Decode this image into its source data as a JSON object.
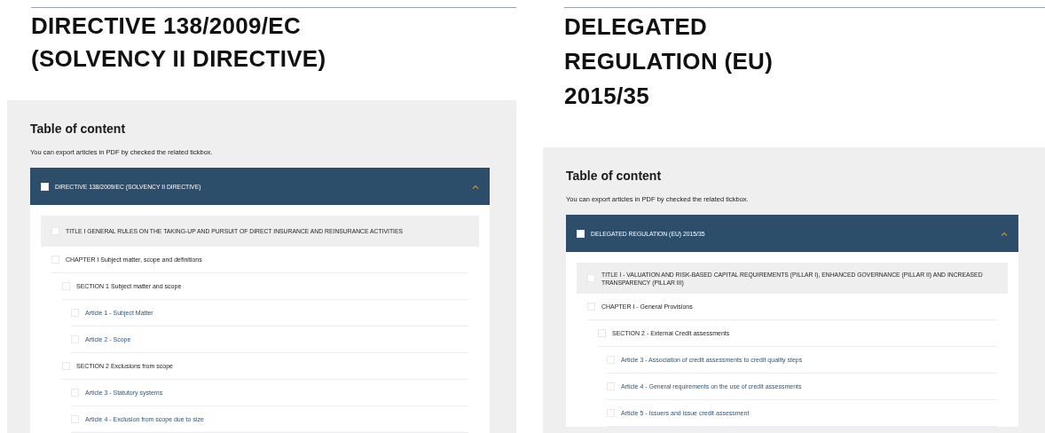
{
  "panels": [
    {
      "heading": [
        "DIRECTIVE 138/2009/EC",
        "(SOLVENCY II DIRECTIVE)"
      ],
      "toc_title": "Table of content",
      "note": "You can export articles in PDF by checked the related tickbox.",
      "root": {
        "label": "DIRECTIVE 138/2009/EC (SOLVENCY II DIRECTIVE)",
        "checked": false,
        "expanded": true,
        "children": [
          {
            "kind": "title",
            "label": "TITLE I GENERAL RULES ON THE TAKING-UP AND PURSUIT OF DIRECT INSURANCE AND REINSURANCE ACTIVITIES",
            "checked": false,
            "children": [
              {
                "kind": "chapter",
                "label": "CHAPTER I Subject matter, scope and definitions",
                "checked": false,
                "children": [
                  {
                    "kind": "section",
                    "label": "SECTION 1 Subject matter and scope",
                    "checked": false,
                    "children": [
                      {
                        "kind": "article",
                        "label": "Article 1 - Subject Matter",
                        "checked": false
                      },
                      {
                        "kind": "article",
                        "label": "Article 2 - Scope",
                        "checked": false
                      }
                    ]
                  },
                  {
                    "kind": "section",
                    "label": "SECTION 2 Exclusions from scope",
                    "checked": false,
                    "children": [
                      {
                        "kind": "article",
                        "label": "Article 3 - Statutory systems",
                        "checked": false
                      },
                      {
                        "kind": "article",
                        "label": "Article 4 - Exclusion from scope due to size",
                        "checked": false
                      }
                    ]
                  }
                ]
              }
            ]
          }
        ]
      }
    },
    {
      "heading": [
        "DELEGATED",
        "REGULATION (EU)",
        "2015/35"
      ],
      "toc_title": "Table of content",
      "note": "You can export articles in PDF by checked the related tickbox.",
      "root": {
        "label": "DELEGATED REGULATION (EU) 2015/35",
        "checked": false,
        "expanded": true,
        "children": [
          {
            "kind": "title",
            "label": "TITLE I - VALUATION AND RISK-BASED CAPITAL REQUIREMENTS (PILLAR I), ENHANCED GOVERNANCE (PILLAR II) AND INCREASED TRANSPARENCY (PILLAR III)",
            "checked": false,
            "children": [
              {
                "kind": "chapter",
                "label": "CHAPTER I - General Provisions",
                "checked": false,
                "children": [
                  {
                    "kind": "section",
                    "label": "SECTION 2 - External Credit assessments",
                    "checked": false,
                    "children": [
                      {
                        "kind": "article",
                        "label": "Article 3 - Association of credit assessments to credit quality steps",
                        "checked": false
                      },
                      {
                        "kind": "article",
                        "label": "Article 4 - General requirements on the use of credit assessments",
                        "checked": false
                      },
                      {
                        "kind": "article",
                        "label": "Article 5 - Issuers and issue credit assessment",
                        "checked": false
                      }
                    ]
                  }
                ]
              }
            ]
          }
        ]
      }
    }
  ]
}
